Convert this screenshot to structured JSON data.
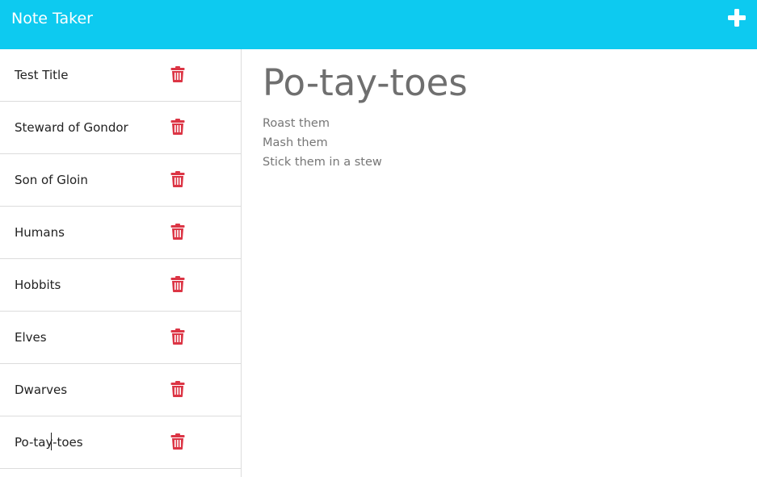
{
  "app": {
    "brand": "Note Taker"
  },
  "colors": {
    "navbar": "#0dcaf0",
    "trash": "#dc3545"
  },
  "icons": {
    "new_note": "plus-icon",
    "delete": "trash-icon"
  },
  "notes": [
    {
      "title": "Test Title"
    },
    {
      "title": "Steward of Gondor"
    },
    {
      "title": "Son of Gloin"
    },
    {
      "title": "Humans"
    },
    {
      "title": "Hobbits"
    },
    {
      "title": "Elves"
    },
    {
      "title": "Dwarves"
    },
    {
      "title": "Po-tay-toes"
    }
  ],
  "active_note": {
    "title": "Po-tay-toes",
    "lines": [
      "Roast them",
      "Mash them",
      "Stick them in a stew"
    ]
  }
}
